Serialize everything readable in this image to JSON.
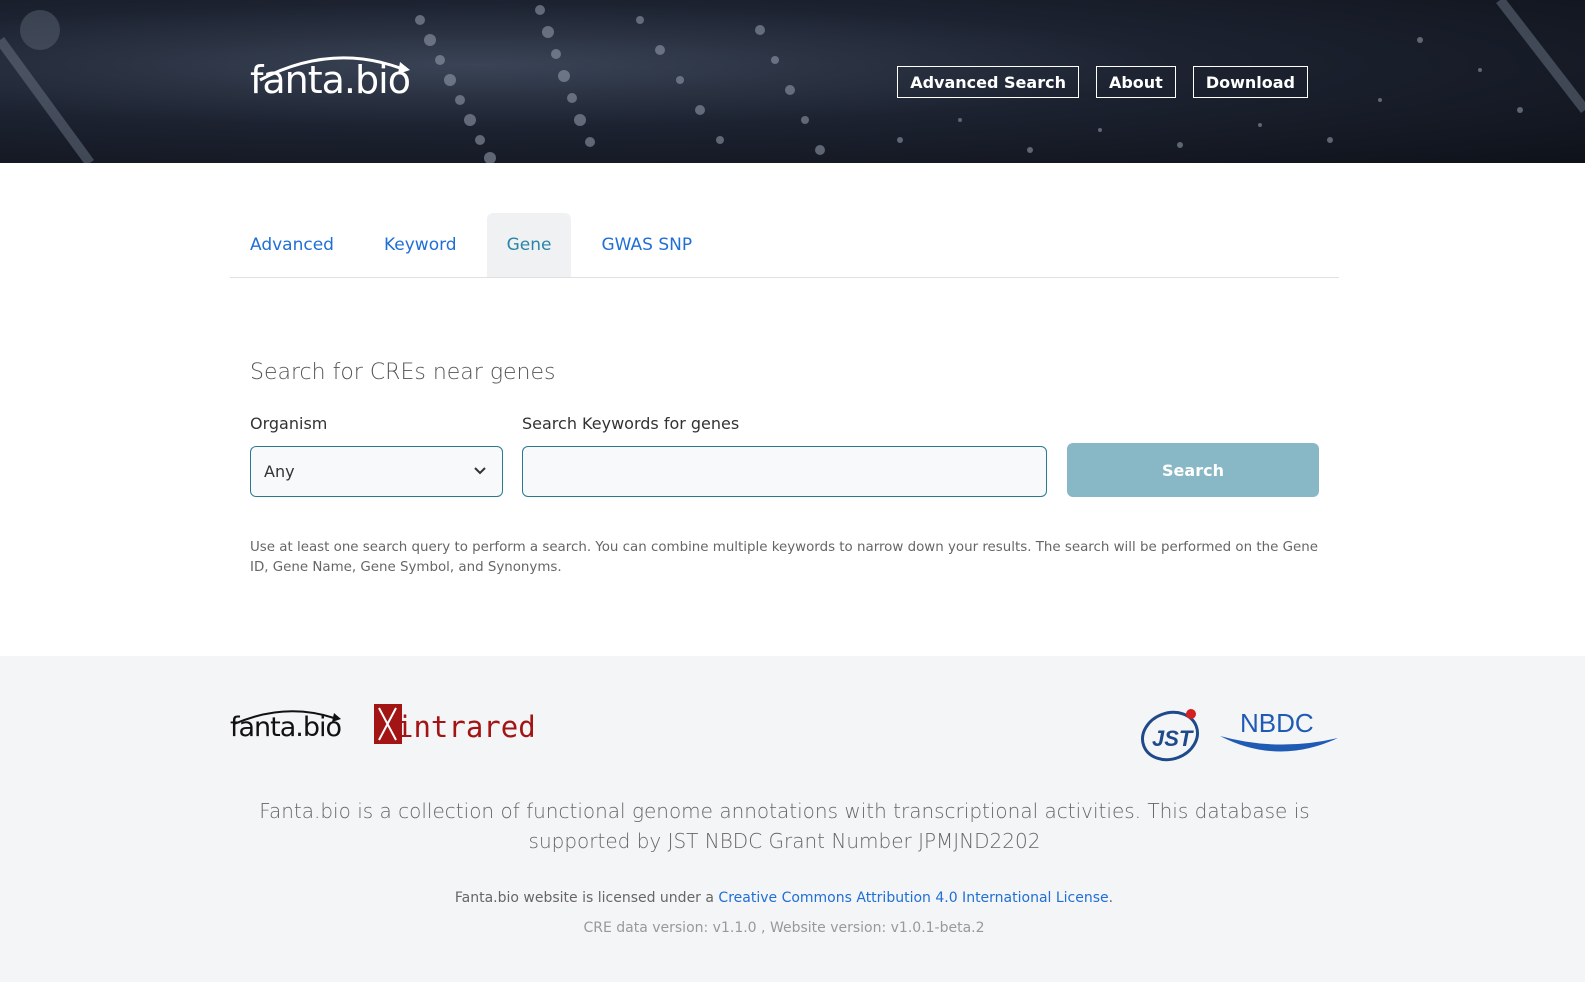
{
  "header": {
    "logo_text": "fanta.bio",
    "nav": [
      {
        "label": "Advanced Search"
      },
      {
        "label": "About"
      },
      {
        "label": "Download"
      }
    ]
  },
  "tabs": [
    {
      "label": "Advanced",
      "active": false
    },
    {
      "label": "Keyword",
      "active": false
    },
    {
      "label": "Gene",
      "active": true
    },
    {
      "label": "GWAS SNP",
      "active": false
    }
  ],
  "search": {
    "heading": "Search for CREs near genes",
    "organism_label": "Organism",
    "organism_value": "Any",
    "keywords_label": "Search Keywords for genes",
    "keywords_value": "",
    "keywords_placeholder": "",
    "button_label": "Search",
    "help_text": "Use at least one search query to perform a search. You can combine multiple keywords to narrow down your results. The search will be performed on the Gene ID, Gene Name, Gene Symbol, and Synonyms."
  },
  "footer": {
    "logo_fanta": "fanta.bio",
    "logo_intrared": "intrared",
    "logo_jst": "JST",
    "logo_nbdc": "NBDC",
    "description": "Fanta.bio is a collection of functional genome annotations with transcriptional activities. This database is supported by JST NBDC Grant Number JPMJND2202",
    "license_prefix": "Fanta.bio website is licensed under a ",
    "license_link": "Creative Commons Attribution 4.0 International License",
    "license_suffix": ".",
    "version": "CRE data version: v1.1.0 , Website version: v1.0.1-beta.2"
  },
  "colors": {
    "accent": "#1f6fd6",
    "active_tab": "#2a86a8",
    "search_button": "#88b8c6",
    "input_border": "#2a7a8f",
    "intrared_red": "#a31515",
    "nbdc_blue": "#1f5bb5"
  },
  "icons": {
    "select_chevron": "chevron-down-icon"
  }
}
